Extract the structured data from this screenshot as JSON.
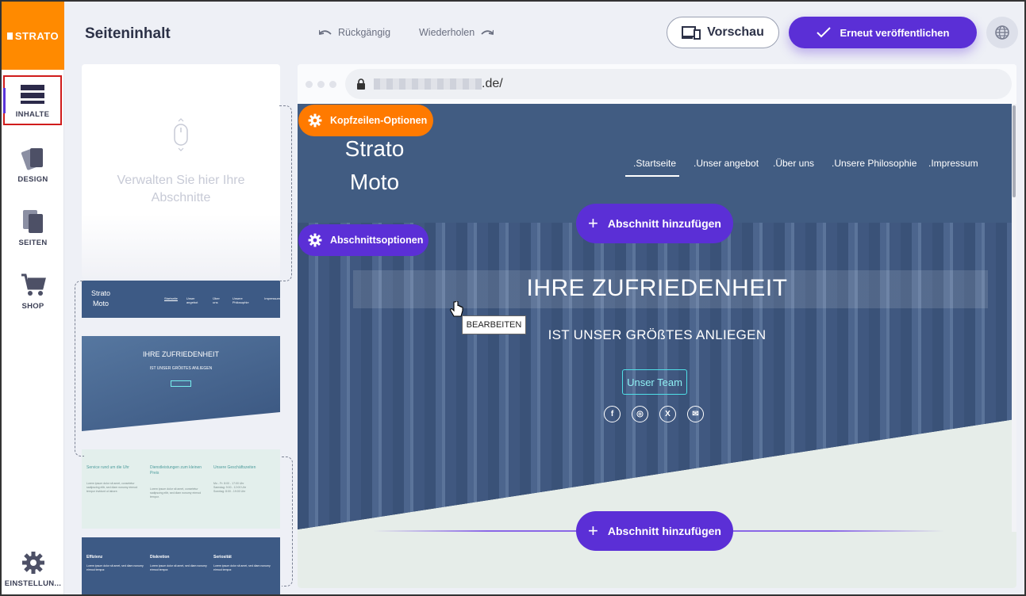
{
  "brand": {
    "logo_text": "STRATO",
    "accent": "#ff8a00",
    "primary": "#5b2fd6"
  },
  "rail": {
    "items": [
      {
        "label": "INHALTE",
        "icon": "content-icon",
        "active": true
      },
      {
        "label": "DESIGN",
        "icon": "palette-icon"
      },
      {
        "label": "SEITEN",
        "icon": "pages-icon"
      },
      {
        "label": "SHOP",
        "icon": "cart-icon"
      },
      {
        "label": "EINSTELLUN...",
        "icon": "gear-icon"
      }
    ]
  },
  "toolbar": {
    "title": "Seiteninhalt",
    "undo_label": "Rückgängig",
    "redo_label": "Wiederholen",
    "preview_label": "Vorschau",
    "publish_label": "Erneut veröffentlichen"
  },
  "sections_panel": {
    "empty_message": "Verwalten Sie hier Ihre Abschnitte",
    "thumb_header": {
      "brand": "Strato\nMoto",
      "nav": [
        "Startseite",
        "Unser angebot",
        "Über uns",
        "Unsere Philosophie",
        "Impressum"
      ]
    },
    "thumb_hero": {
      "title": "IHRE ZUFRIEDENHEIT",
      "subtitle": "IST UNSER GRÖßTES ANLIEGEN",
      "button": "Unser Team"
    },
    "thumb_services": {
      "cols": [
        "Service rund um die Uhr",
        "Dienstleistungen zum kleinen Preis",
        "Unsere Geschäftszeiten"
      ]
    },
    "thumb_features": {
      "cols": [
        "Effizienz",
        "Diskretion",
        "Seriosität"
      ]
    }
  },
  "browser": {
    "url_suffix": ".de/"
  },
  "site": {
    "brand_line1": "Strato",
    "brand_line2": "Moto",
    "nav": [
      ".Startseite",
      ".Unser angebot",
      ".Über uns",
      ".Unsere Philosophie",
      ".Impressum"
    ],
    "hero_title": "IHRE ZUFRIEDENHEIT",
    "hero_subtitle": "IST UNSER GRÖßTES ANLIEGEN",
    "hero_button": "Unser Team",
    "socials": [
      "f",
      "◎",
      "X",
      "✉"
    ]
  },
  "controls": {
    "header_options": "Kopfzeilen-Optionen",
    "section_options": "Abschnittsoptionen",
    "add_section": "Abschnitt hinzufügen",
    "tooltip": "BEARBEITEN"
  }
}
